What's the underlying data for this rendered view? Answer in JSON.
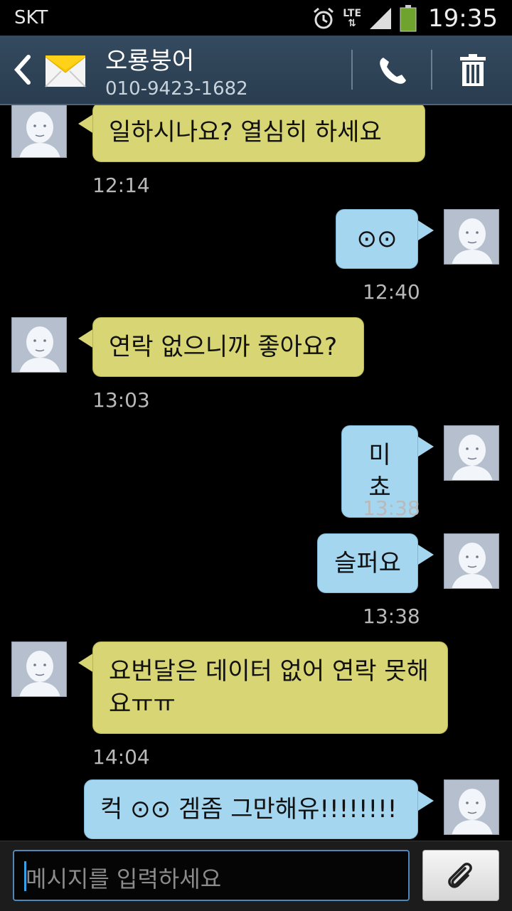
{
  "status_bar": {
    "carrier": "SKT",
    "network": "LTE",
    "time": "19:35"
  },
  "header": {
    "contact_name": "오룡붕어",
    "contact_number": "010-9423-1682"
  },
  "messages": [
    {
      "direction": "incoming",
      "text": "일하시나요?  열심히  하세요",
      "time": "12:14"
    },
    {
      "direction": "outgoing",
      "text": "⊙⊙",
      "time": "12:40"
    },
    {
      "direction": "incoming",
      "text": "연락 없으니까 좋아요?",
      "time": "13:03"
    },
    {
      "direction": "outgoing",
      "text": "미쵸",
      "time": "13:38"
    },
    {
      "direction": "outgoing",
      "text": "슬퍼요",
      "time": "13:38"
    },
    {
      "direction": "incoming",
      "text": "요번달은 데이터 없어 연락 못해요ㅠㅠ",
      "time": "14:04"
    },
    {
      "direction": "outgoing",
      "text": "컥 ⊙⊙  겜좀 그만해유!!!!!!!!",
      "time": ""
    }
  ],
  "composer": {
    "placeholder": "메시지를 입력하세요"
  },
  "colors": {
    "incoming_bubble": "#d8d574",
    "outgoing_bubble": "#a5d6ef",
    "header": "#2f4356"
  },
  "icons": [
    "back-arrow-icon",
    "envelope-icon",
    "phone-icon",
    "trash-icon",
    "paperclip-icon",
    "alarm-icon",
    "signal-icon",
    "battery-icon"
  ]
}
